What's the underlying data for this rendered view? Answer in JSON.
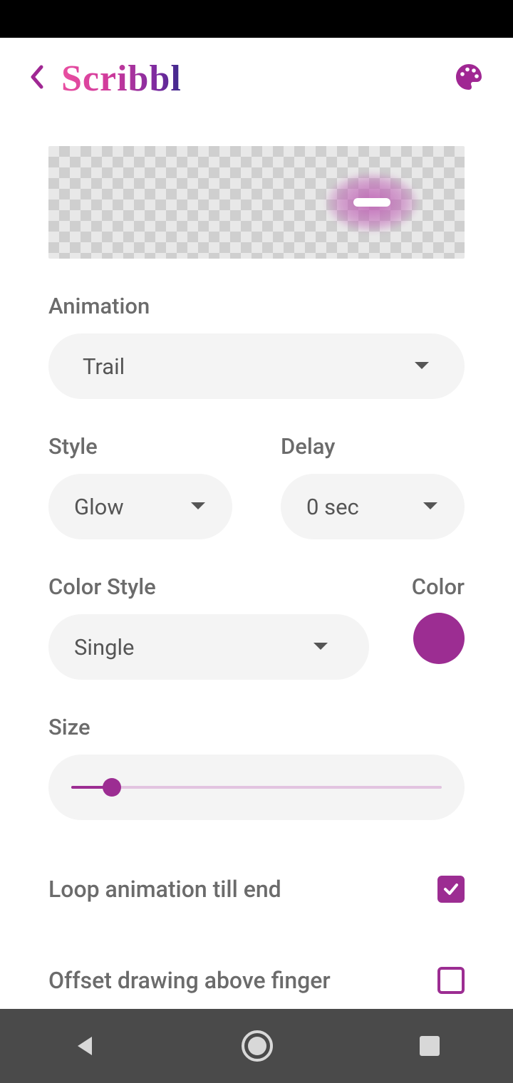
{
  "header": {
    "logo_text": "Scribbl"
  },
  "labels": {
    "animation": "Animation",
    "style": "Style",
    "delay": "Delay",
    "color_style": "Color Style",
    "color": "Color",
    "size": "Size"
  },
  "dropdowns": {
    "animation_value": "Trail",
    "style_value": "Glow",
    "delay_value": "0 sec",
    "color_style_value": "Single"
  },
  "color_hex": "#9c2d92",
  "size_percent": 11,
  "options": {
    "loop_label": "Loop animation till end",
    "loop_checked": true,
    "offset_label": "Offset drawing above finger",
    "offset_checked": false
  }
}
